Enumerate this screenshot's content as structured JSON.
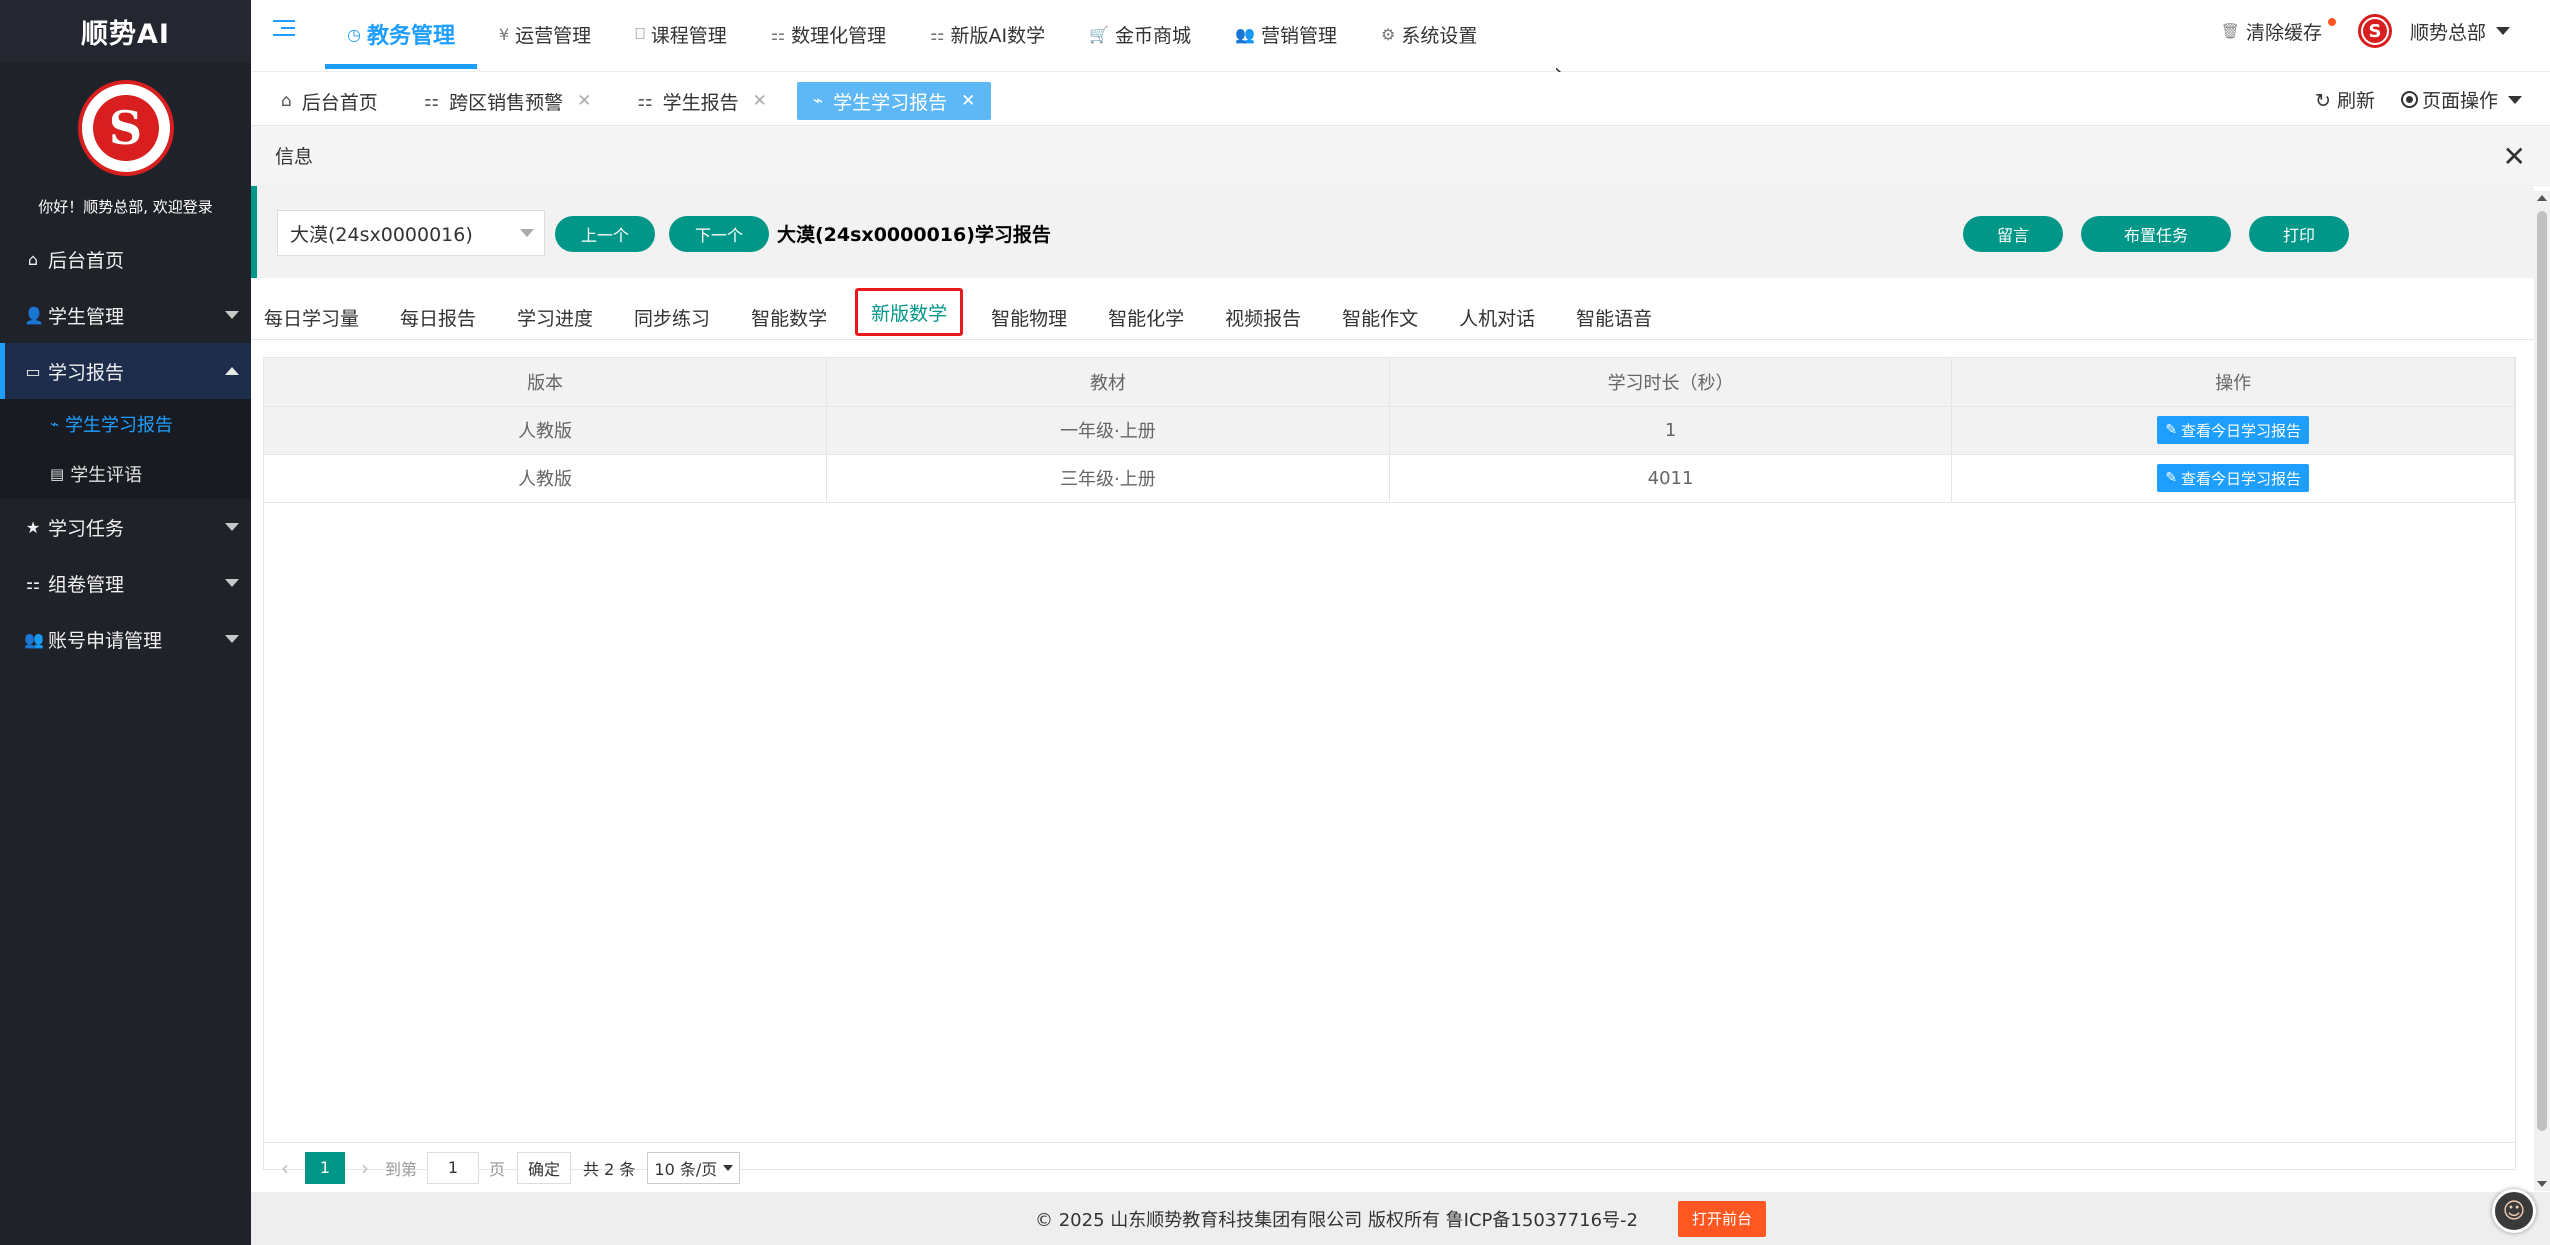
{
  "sidebar": {
    "brand": "顺势AI",
    "logo_letter": "S",
    "welcome": "你好！顺势总部, 欢迎登录",
    "items": [
      {
        "label": "后台首页",
        "icon": "⌂"
      },
      {
        "label": "学生管理",
        "icon": "👤"
      },
      {
        "label": "学习报告",
        "icon": "▭"
      },
      {
        "label": "学习任务",
        "icon": "★"
      },
      {
        "label": "组卷管理",
        "icon": "⚏"
      },
      {
        "label": "账号申请管理",
        "icon": "👥"
      }
    ],
    "subitems": [
      {
        "label": "学生学习报告",
        "icon": "⌁"
      },
      {
        "label": "学生评语",
        "icon": "▤"
      }
    ]
  },
  "topnav": {
    "items": [
      {
        "label": "教务管理",
        "icon": "◷"
      },
      {
        "label": "运营管理",
        "icon": "¥"
      },
      {
        "label": "课程管理",
        "icon": "⎕"
      },
      {
        "label": "数理化管理",
        "icon": "⚏"
      },
      {
        "label": "新版AI数学",
        "icon": "⚏"
      },
      {
        "label": "金币商城",
        "icon": "🛒"
      },
      {
        "label": "营销管理",
        "icon": "👥"
      },
      {
        "label": "系统设置",
        "icon": "⚙"
      }
    ],
    "more": "›",
    "clear_cache": "清除缓存",
    "user": "顺势总部",
    "avatar_letter": "S"
  },
  "tabs": {
    "items": [
      {
        "label": "后台首页",
        "icon": "⌂"
      },
      {
        "label": "跨区销售预警",
        "icon": "⚏"
      },
      {
        "label": "学生报告",
        "icon": "⚏"
      },
      {
        "label": "学生学习报告",
        "icon": "⌁"
      }
    ],
    "close": "✕",
    "refresh": "刷新",
    "page_ops": "页面操作"
  },
  "panel": {
    "title": "信息",
    "close": "✕",
    "student": "大漠(24sx0000016)",
    "prev": "上一个",
    "next": "下一个",
    "report_title": "大漠(24sx0000016)学习报告",
    "btn_message": "留言",
    "btn_assign": "布置任务",
    "btn_print": "打印",
    "subtabs": [
      "每日学习量",
      "每日报告",
      "学习进度",
      "同步练习",
      "智能数学",
      "新版数学",
      "智能物理",
      "智能化学",
      "视频报告",
      "智能作文",
      "人机对话",
      "智能语音"
    ],
    "table": {
      "headers": [
        "版本",
        "教材",
        "学习时长（秒）",
        "操作"
      ],
      "rows": [
        {
          "version": "人教版",
          "textbook": "一年级·上册",
          "duration": "1",
          "action": "查看今日学习报告"
        },
        {
          "version": "人教版",
          "textbook": "三年级·上册",
          "duration": "4011",
          "action": "查看今日学习报告"
        }
      ]
    },
    "pager": {
      "current": "1",
      "goto_label": "到第",
      "goto_value": "1",
      "page_unit": "页",
      "confirm": "确定",
      "total": "共 2 条",
      "page_size": "10 条/页"
    }
  },
  "footer": {
    "copyright": "© 2025 山东顺势教育科技集团有限公司 版权所有 鲁ICP备15037716号-2",
    "open_front": "打开前台"
  },
  "colors": {
    "primary": "#009688",
    "accent": "#1e9fff",
    "sidebar": "#20222a",
    "danger": "#ff5722"
  }
}
